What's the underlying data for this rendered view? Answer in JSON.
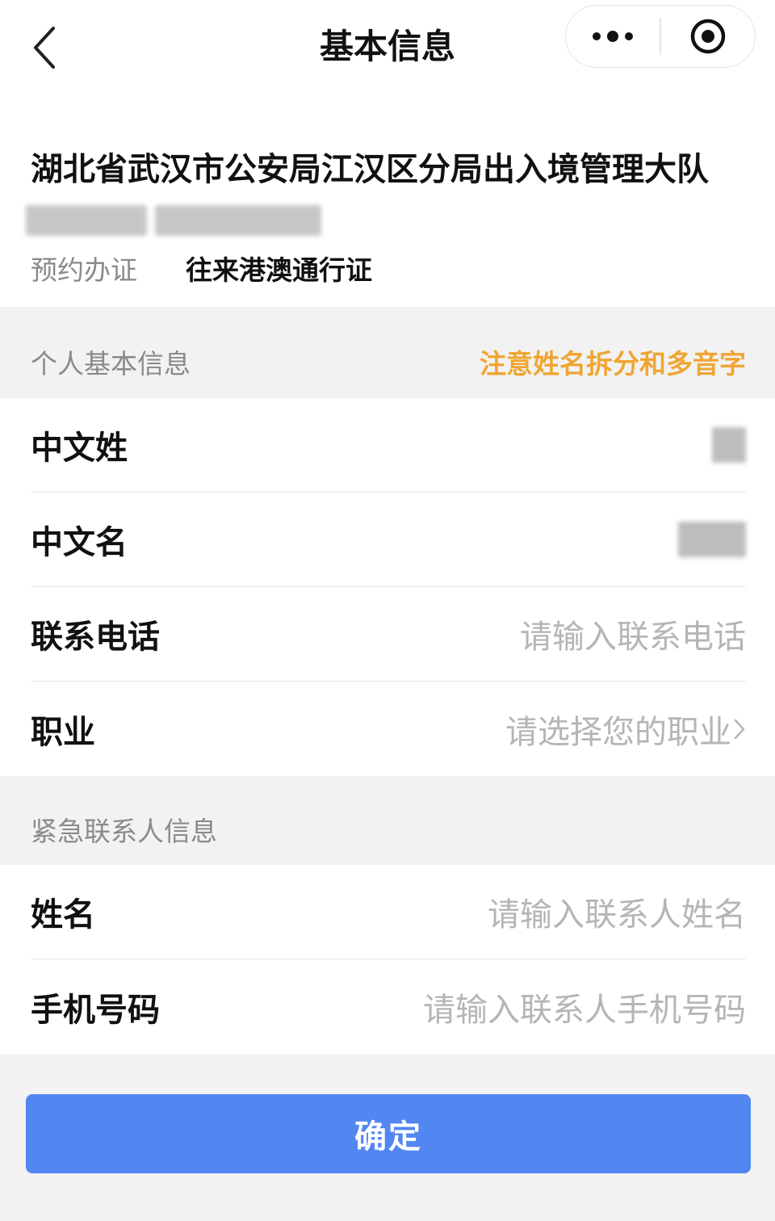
{
  "nav": {
    "title": "基本信息",
    "back_icon": "chevron-left-icon",
    "more_icon": "more-dots-icon",
    "close_icon": "record-target-icon"
  },
  "office": {
    "name": "湖北省武汉市公安局江汉区分局出入境管理大队",
    "appointment_label": "预约办证",
    "appointment_value": "往来港澳通行证"
  },
  "personal": {
    "section_title": "个人基本信息",
    "note": "注意姓名拆分和多音字",
    "note_color": "#f0a531",
    "fields": [
      {
        "label": "中文姓",
        "placeholder": ""
      },
      {
        "label": "中文名",
        "placeholder": ""
      },
      {
        "label": "联系电话",
        "placeholder": "请输入联系电话"
      },
      {
        "label": "职业",
        "placeholder": "请选择您的职业"
      }
    ]
  },
  "emergency": {
    "section_title": "紧急联系人信息",
    "fields": [
      {
        "label": "姓名",
        "placeholder": "请输入联系人姓名"
      },
      {
        "label": "手机号码",
        "placeholder": "请输入联系人手机号码"
      }
    ]
  },
  "confirm": {
    "label": "确定",
    "color": "#5286f1"
  }
}
